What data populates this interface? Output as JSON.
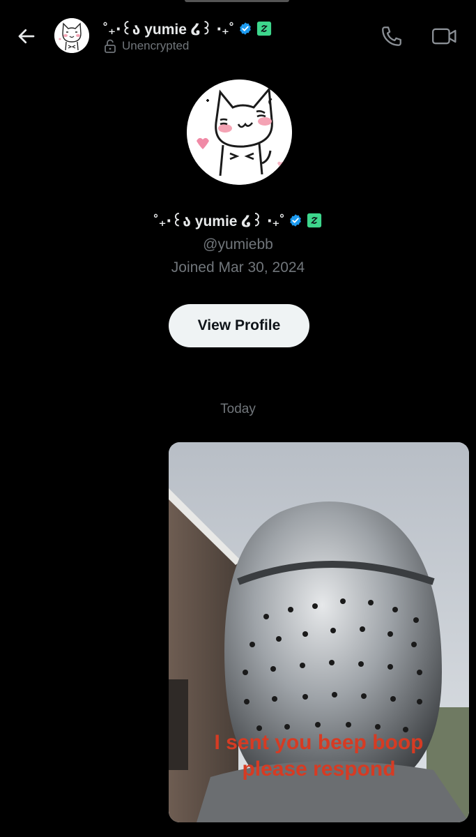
{
  "header": {
    "back_icon": "arrow-left-icon",
    "name": "˚₊‧꒰ა yumie ໒꒱ ‧₊˚",
    "verified_icon": "verified-badge-icon",
    "affiliate_icon": "green-affiliate-badge-icon",
    "encryption_icon": "unlocked-padlock-icon",
    "encryption_status": "Unencrypted",
    "call_icon": "phone-icon",
    "video_icon": "video-camera-icon"
  },
  "profile": {
    "avatar_icon": "cat-avatar",
    "name": "˚₊‧꒰ა yumie ໒꒱ ‧₊˚",
    "handle": "@yumiebb",
    "joined": "Joined Mar 30, 2024",
    "view_profile_label": "View Profile"
  },
  "conversation": {
    "date_separator": "Today",
    "message_image": {
      "description_icon": "knight-helmet-photo",
      "caption_line1": "I sent you beep boop",
      "caption_line2": "please respond"
    }
  },
  "colors": {
    "background": "#000000",
    "text_primary": "#e7e9ea",
    "text_secondary": "#71767b",
    "verified_blue": "#1d9bf0",
    "affiliate_green": "#3dd68c",
    "caption_red": "#d63b23",
    "button_bg": "#eff3f4"
  }
}
